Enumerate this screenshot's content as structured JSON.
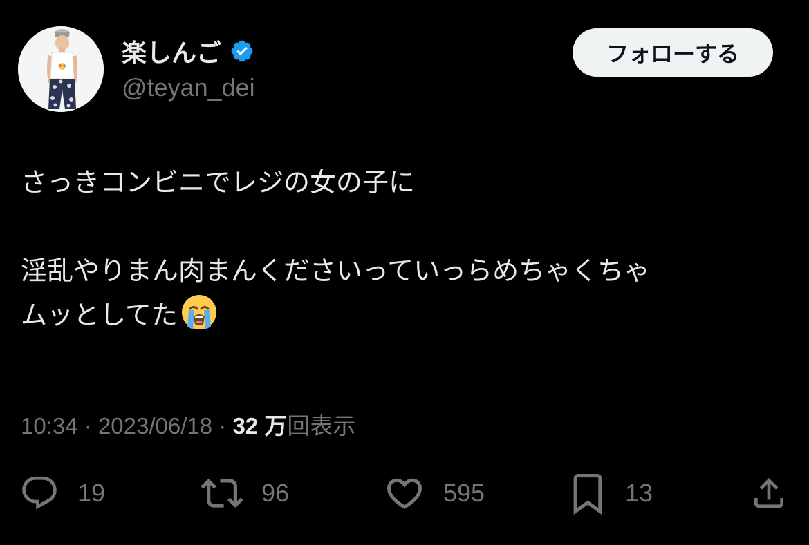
{
  "user": {
    "display_name": "楽しんご",
    "handle": "@teyan_dei",
    "verified": true,
    "verified_color": "#1d9bf0"
  },
  "follow_button": {
    "label": "フォローする"
  },
  "tweet": {
    "line1": "さっきコンビニでレジの女の子に",
    "line2": "淫乱やりまん肉まんくださいっていっらめちゃくちゃ",
    "line3": "ムッとしてた",
    "emoji": "loudly-crying-face"
  },
  "meta": {
    "time": "10:34",
    "separator": "·",
    "date": "2023/06/18",
    "views_count": "32 万",
    "views_label": "回表示"
  },
  "actions": {
    "replies": "19",
    "retweets": "96",
    "likes": "595",
    "bookmarks": "13"
  },
  "colors": {
    "background": "#000000",
    "text_primary": "#e7e9ea",
    "text_secondary": "#71767b",
    "button_bg": "#eff3f4"
  }
}
